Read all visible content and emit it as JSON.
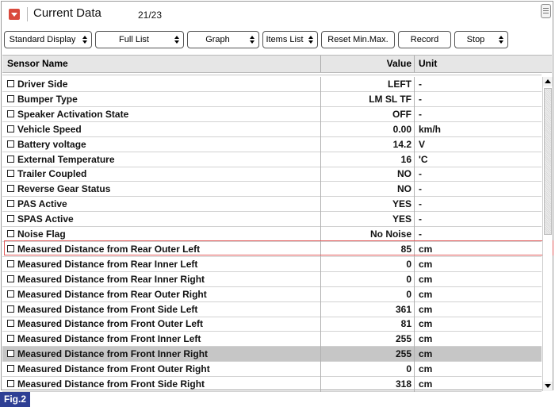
{
  "header": {
    "title": "Current Data",
    "counter": "21/23"
  },
  "toolbar": {
    "standard_display": "Standard Display",
    "full_list": "Full List",
    "graph": "Graph",
    "items_list": "Items List",
    "reset_min_max": "Reset Min.Max.",
    "record": "Record",
    "stop": "Stop"
  },
  "table": {
    "columns": {
      "name": "Sensor Name",
      "value": "Value",
      "unit": "Unit"
    },
    "rows": [
      {
        "name": "Driver Side",
        "value": "LEFT",
        "unit": "-"
      },
      {
        "name": "Bumper Type",
        "value": "LM SL TF",
        "unit": "-"
      },
      {
        "name": "Speaker Activation State",
        "value": "OFF",
        "unit": "-"
      },
      {
        "name": "Vehicle Speed",
        "value": "0.00",
        "unit": "km/h"
      },
      {
        "name": "Battery voltage",
        "value": "14.2",
        "unit": "V"
      },
      {
        "name": "External Temperature",
        "value": "16",
        "unit": "'C"
      },
      {
        "name": "Trailer Coupled",
        "value": "NO",
        "unit": "-"
      },
      {
        "name": "Reverse Gear Status",
        "value": "NO",
        "unit": "-"
      },
      {
        "name": "PAS Active",
        "value": "YES",
        "unit": "-"
      },
      {
        "name": "SPAS Active",
        "value": "YES",
        "unit": "-"
      },
      {
        "name": "Noise Flag",
        "value": "No Noise",
        "unit": "-"
      },
      {
        "name": "Measured Distance from Rear Outer Left",
        "value": "85",
        "unit": "cm"
      },
      {
        "name": "Measured Distance from Rear Inner Left",
        "value": "0",
        "unit": "cm"
      },
      {
        "name": "Measured Distance from Rear Inner Right",
        "value": "0",
        "unit": "cm"
      },
      {
        "name": "Measured Distance from Rear Outer Right",
        "value": "0",
        "unit": "cm"
      },
      {
        "name": "Measured Distance from Front Side Left",
        "value": "361",
        "unit": "cm"
      },
      {
        "name": "Measured Distance from Front Outer Left",
        "value": "81",
        "unit": "cm"
      },
      {
        "name": "Measured Distance from Front Inner Left",
        "value": "255",
        "unit": "cm"
      },
      {
        "name": "Measured Distance from Front Inner Right",
        "value": "255",
        "unit": "cm"
      },
      {
        "name": "Measured Distance from Front Outer Right",
        "value": "0",
        "unit": "cm"
      },
      {
        "name": "Measured Distance from Front Side Right",
        "value": "318",
        "unit": "cm"
      }
    ]
  },
  "figure_label": "Fig.2",
  "colors": {
    "collapse_button": "#d94a3d",
    "highlight_border": "#e15b5b",
    "selected_row": "#c6c6c6",
    "fig_label_bg": "#2e3f94",
    "header_bg": "#e6e6e6"
  },
  "icons": {
    "collapse": "caret-down-icon",
    "menu": "list-menu-icon",
    "checkbox": "checkbox-icon",
    "scroll_up": "scroll-up-icon",
    "scroll_down": "scroll-down-icon"
  }
}
